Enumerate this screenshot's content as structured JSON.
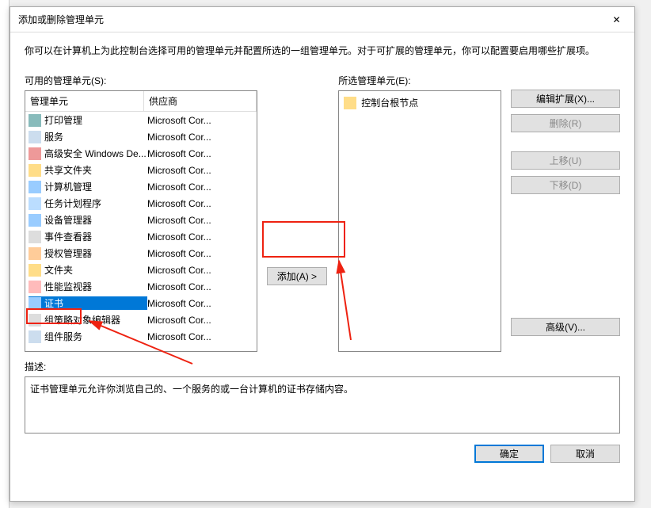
{
  "dialog": {
    "title": "添加或删除管理单元",
    "intro": "你可以在计算机上为此控制台选择可用的管理单元并配置所选的一组管理单元。对于可扩展的管理单元，你可以配置要启用哪些扩展项。"
  },
  "left": {
    "label": "可用的管理单元(S):",
    "col_name": "管理单元",
    "col_vendor": "供应商",
    "items": [
      {
        "icon": "ic-print",
        "name": "打印管理",
        "vendor": "Microsoft Cor..."
      },
      {
        "icon": "ic-service",
        "name": "服务",
        "vendor": "Microsoft Cor..."
      },
      {
        "icon": "ic-firewall",
        "name": "高级安全 Windows De...",
        "vendor": "Microsoft Cor..."
      },
      {
        "icon": "ic-share",
        "name": "共享文件夹",
        "vendor": "Microsoft Cor..."
      },
      {
        "icon": "ic-computer",
        "name": "计算机管理",
        "vendor": "Microsoft Cor..."
      },
      {
        "icon": "ic-task",
        "name": "任务计划程序",
        "vendor": "Microsoft Cor..."
      },
      {
        "icon": "ic-device",
        "name": "设备管理器",
        "vendor": "Microsoft Cor..."
      },
      {
        "icon": "ic-event",
        "name": "事件查看器",
        "vendor": "Microsoft Cor..."
      },
      {
        "icon": "ic-auth",
        "name": "授权管理器",
        "vendor": "Microsoft Cor..."
      },
      {
        "icon": "ic-folder",
        "name": "文件夹",
        "vendor": "Microsoft Cor..."
      },
      {
        "icon": "ic-perf",
        "name": "性能监视器",
        "vendor": "Microsoft Cor..."
      },
      {
        "icon": "ic-cert",
        "name": "证书",
        "vendor": "Microsoft Cor...",
        "selected": true
      },
      {
        "icon": "ic-policy",
        "name": "组策略对象编辑器",
        "vendor": "Microsoft Cor..."
      },
      {
        "icon": "ic-component",
        "name": "组件服务",
        "vendor": "Microsoft Cor..."
      }
    ]
  },
  "middle": {
    "add": "添加(A) >"
  },
  "selected": {
    "label": "所选管理单元(E):",
    "root": "控制台根节点"
  },
  "right": {
    "edit_ext": "编辑扩展(X)...",
    "remove": "删除(R)",
    "move_up": "上移(U)",
    "move_down": "下移(D)",
    "advanced": "高级(V)..."
  },
  "desc": {
    "label": "描述:",
    "text": "证书管理单元允许你浏览自己的、一个服务的或一台计算机的证书存储内容。"
  },
  "footer": {
    "ok": "确定",
    "cancel": "取消"
  }
}
